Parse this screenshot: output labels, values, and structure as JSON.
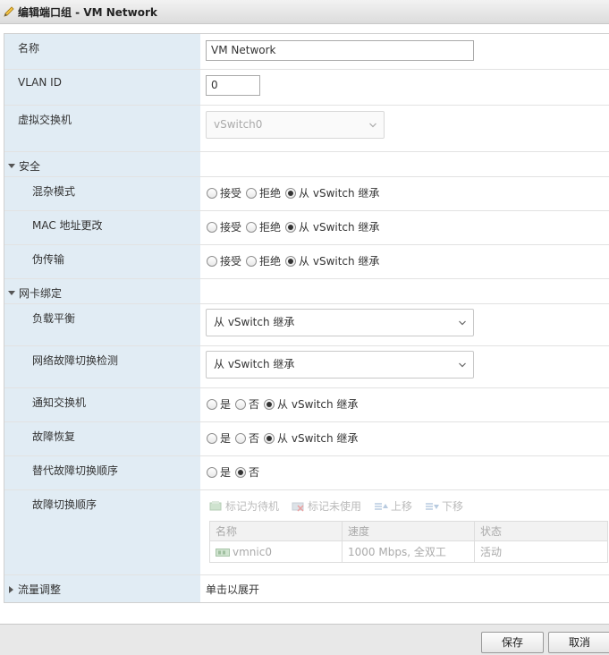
{
  "window": {
    "title": "编辑端口组 - VM Network"
  },
  "fields": {
    "name": {
      "label": "名称",
      "value": "VM Network"
    },
    "vlan": {
      "label": "VLAN ID",
      "value": "0"
    },
    "vswitch": {
      "label": "虚拟交换机",
      "value": "vSwitch0"
    }
  },
  "security": {
    "header": "安全",
    "promiscuous": {
      "label": "混杂模式",
      "options": [
        "接受",
        "拒绝",
        "从 vSwitch 继承"
      ],
      "selected": 2
    },
    "mac_change": {
      "label": "MAC 地址更改",
      "options": [
        "接受",
        "拒绝",
        "从 vSwitch 继承"
      ],
      "selected": 2
    },
    "forged": {
      "label": "伪传输",
      "options": [
        "接受",
        "拒绝",
        "从 vSwitch 继承"
      ],
      "selected": 2
    }
  },
  "teaming": {
    "header": "网卡绑定",
    "load_balancing": {
      "label": "负载平衡",
      "value": "从 vSwitch 继承"
    },
    "failover_detection": {
      "label": "网络故障切换检测",
      "value": "从 vSwitch 继承"
    },
    "notify_switches": {
      "label": "通知交换机",
      "options": [
        "是",
        "否",
        "从 vSwitch 继承"
      ],
      "selected": 2
    },
    "failback": {
      "label": "故障恢复",
      "options": [
        "是",
        "否",
        "从 vSwitch 继承"
      ],
      "selected": 2
    },
    "override_order": {
      "label": "替代故障切换顺序",
      "options": [
        "是",
        "否"
      ],
      "selected": 1
    },
    "failover_order": {
      "label": "故障切换顺序",
      "toolbar": {
        "standby": "标记为待机",
        "unused": "标记未使用",
        "up": "上移",
        "down": "下移"
      },
      "columns": [
        "名称",
        "速度",
        "状态"
      ],
      "rows": [
        {
          "name": "vmnic0",
          "speed": "1000 Mbps, 全双工",
          "status": "活动"
        }
      ]
    }
  },
  "shaping": {
    "header": "流量调整",
    "value": "单击以展开"
  },
  "buttons": {
    "save": "保存",
    "cancel": "取消"
  },
  "colors": {
    "label_bg": "#e1ecf4",
    "footer_bg": "#e8e8e8"
  }
}
